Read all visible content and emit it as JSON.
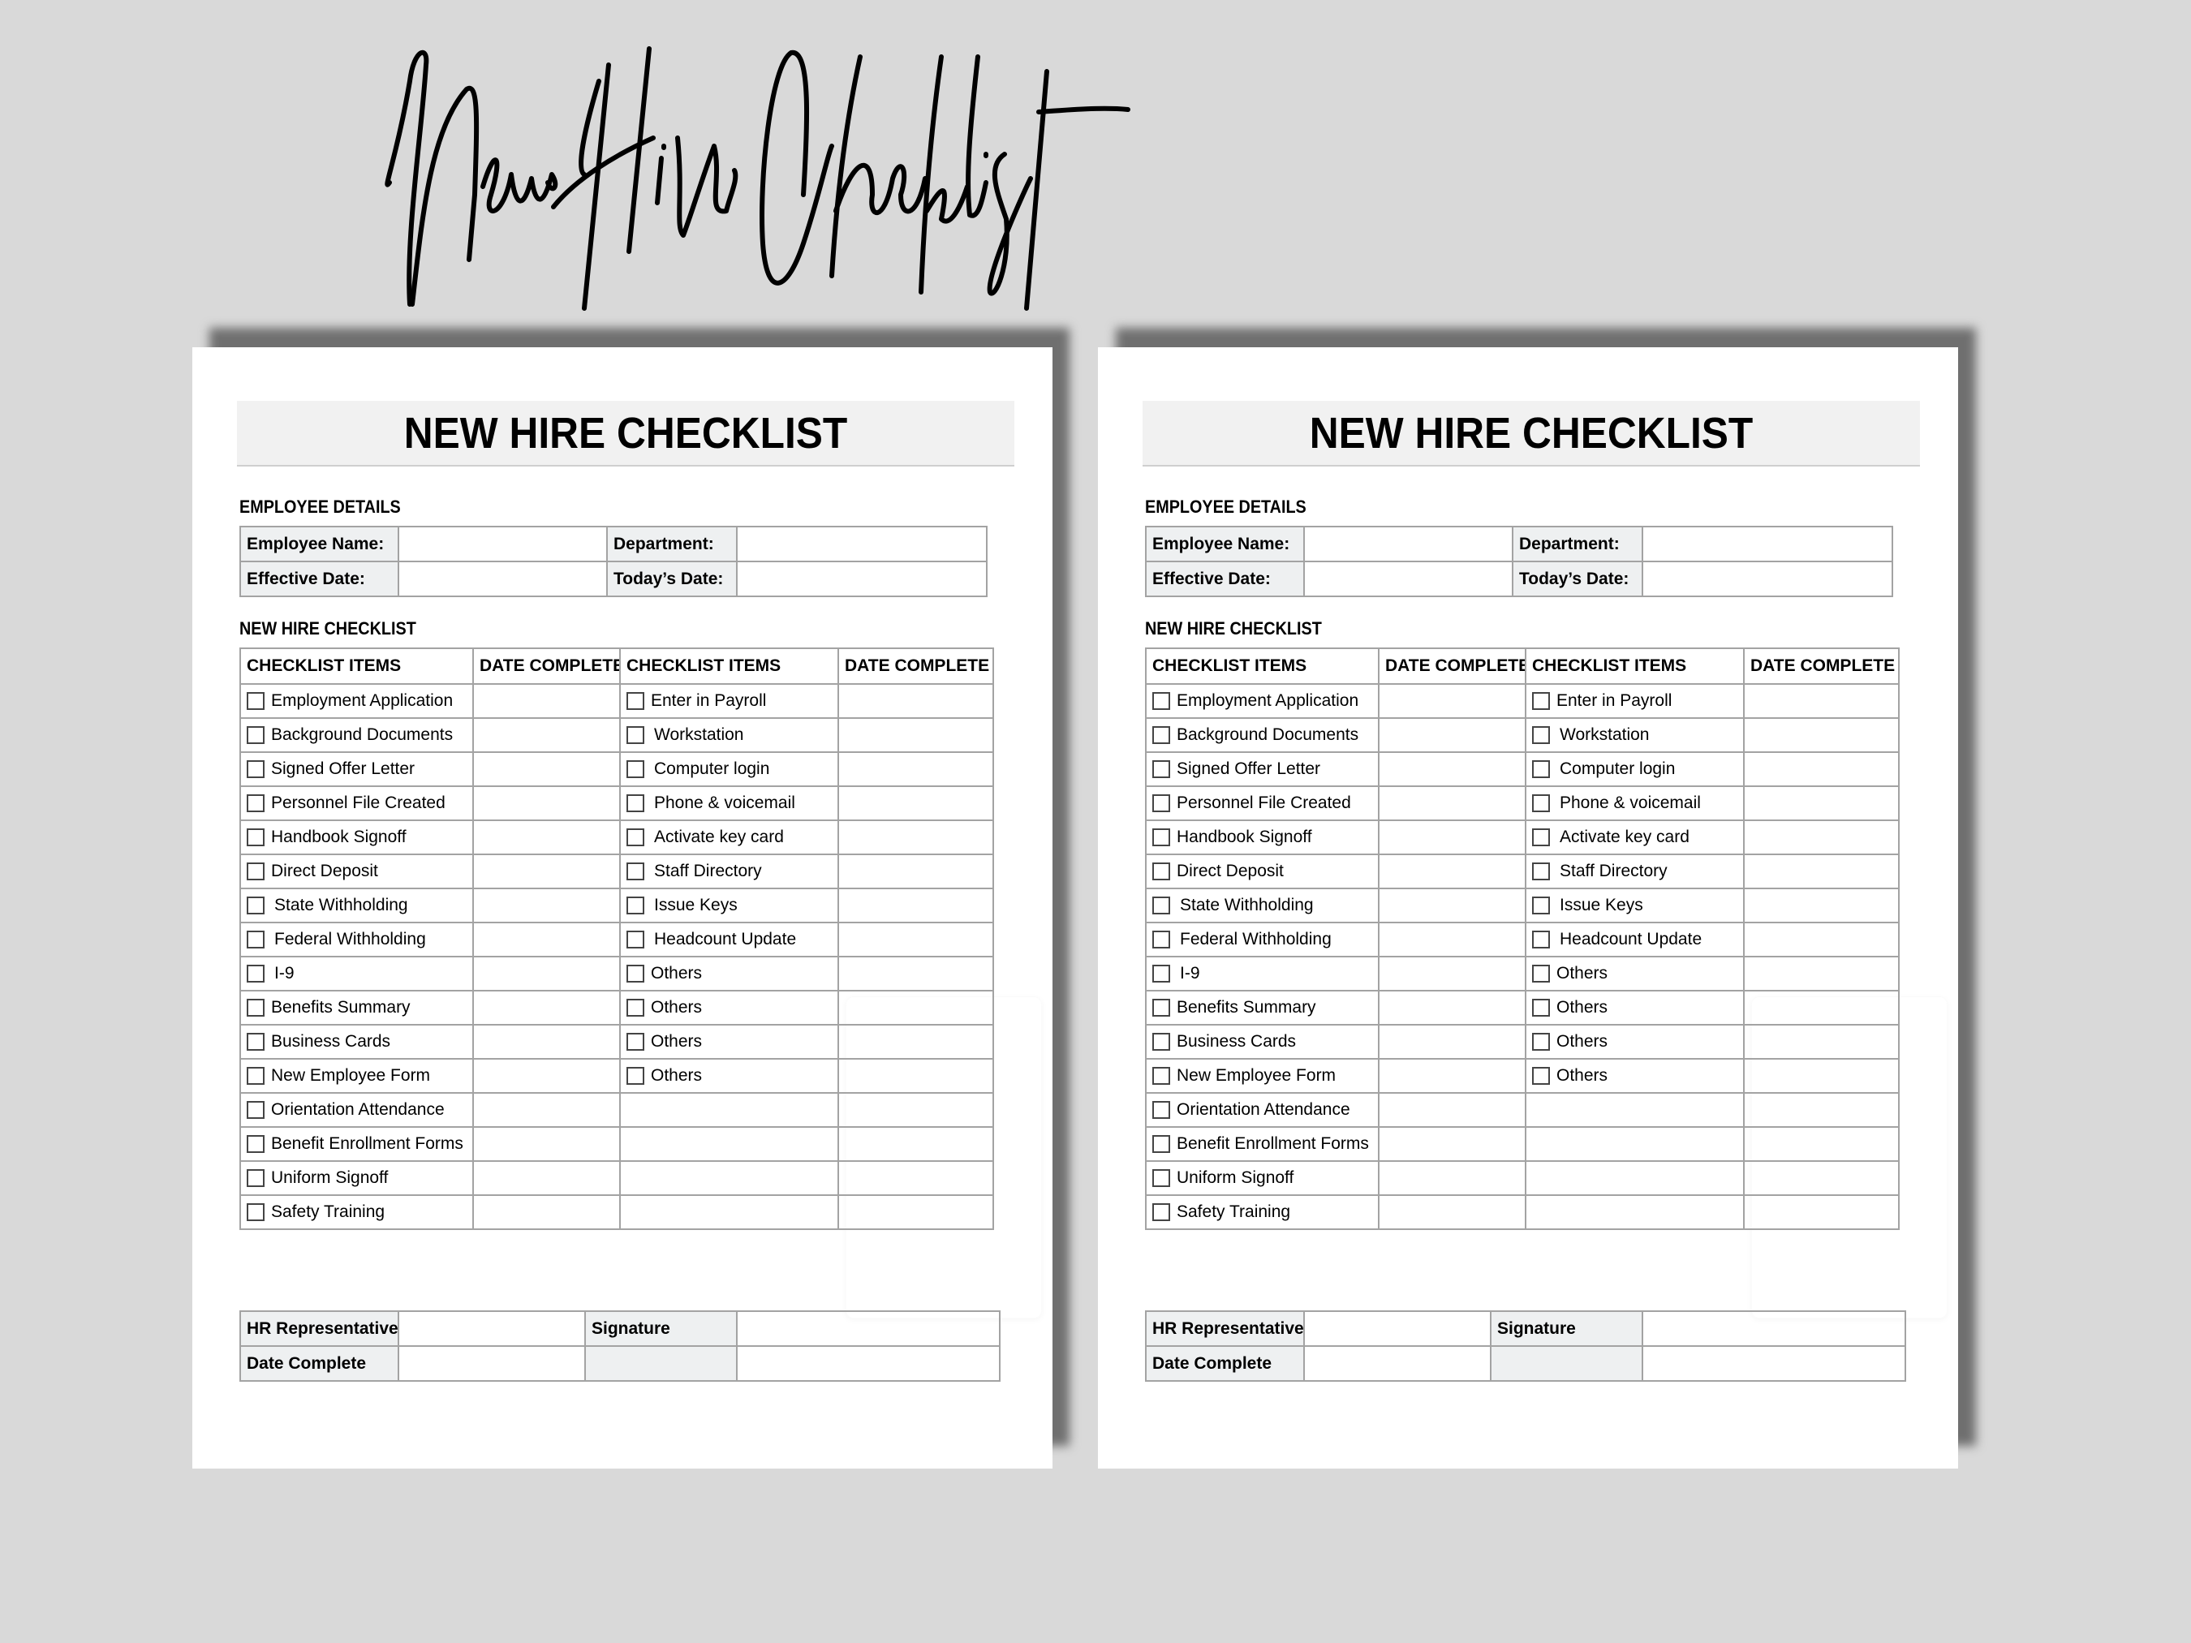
{
  "header": {
    "script_title": "New Hire Checklist"
  },
  "pages": [
    {
      "title": "NEW HIRE CHECKLIST",
      "employee_details": {
        "section_label": "EMPLOYEE DETAILS",
        "employee_name_label": "Employee Name:",
        "employee_name_value": "",
        "department_label": "Department:",
        "department_value": "",
        "effective_date_label": "Effective Date:",
        "effective_date_value": "",
        "todays_date_label": "Today’s Date:",
        "todays_date_value": ""
      },
      "checklist": {
        "section_label": "NEW HIRE CHECKLIST",
        "headers": [
          "CHECKLIST ITEMS",
          "DATE COMPLETE",
          "CHECKLIST ITEMS",
          "DATE COMPLETE"
        ],
        "left_items": [
          "Employment Application",
          "Background Documents",
          "Signed Offer Letter",
          "Personnel File Created",
          "Handbook Signoff",
          "Direct Deposit",
          "State Withholding",
          "Federal Withholding",
          "I-9",
          "Benefits Summary",
          "Business Cards",
          "New Employee Form",
          "Orientation Attendance",
          "Benefit Enrollment Forms",
          "Uniform Signoff",
          "Safety Training"
        ],
        "right_items": [
          "Enter in Payroll",
          "Workstation",
          "Computer login",
          "Phone & voicemail",
          "Activate key card",
          "Staff Directory",
          "Issue Keys",
          "Headcount Update",
          "Others",
          "Others",
          "Others",
          "Others"
        ]
      },
      "footer": {
        "hr_rep_label": "HR Representative",
        "signature_label": "Signature",
        "date_complete_label": "Date Complete"
      }
    },
    {
      "title": "NEW HIRE CHECKLIST",
      "employee_details": {
        "section_label": "EMPLOYEE DETAILS",
        "employee_name_label": "Employee Name:",
        "employee_name_value": "",
        "department_label": "Department:",
        "department_value": "",
        "effective_date_label": "Effective Date:",
        "effective_date_value": "",
        "todays_date_label": "Today’s Date:",
        "todays_date_value": ""
      },
      "checklist": {
        "section_label": "NEW HIRE CHECKLIST",
        "headers": [
          "CHECKLIST ITEMS",
          "DATE COMPLETE",
          "CHECKLIST ITEMS",
          "DATE COMPLETE"
        ],
        "left_items": [
          "Employment Application",
          "Background Documents",
          "Signed Offer Letter",
          "Personnel File Created",
          "Handbook Signoff",
          "Direct Deposit",
          "State Withholding",
          "Federal Withholding",
          "I-9",
          "Benefits Summary",
          "Business Cards",
          "New Employee Form",
          "Orientation Attendance",
          "Benefit Enrollment Forms",
          "Uniform Signoff",
          "Safety Training"
        ],
        "right_items": [
          "Enter in Payroll",
          "Workstation",
          "Computer login",
          "Phone & voicemail",
          "Activate key card",
          "Staff Directory",
          "Issue Keys",
          "Headcount Update",
          "Others",
          "Others",
          "Others",
          "Others"
        ]
      },
      "footer": {
        "hr_rep_label": "HR Representative",
        "signature_label": "Signature",
        "date_complete_label": "Date Complete"
      }
    }
  ]
}
